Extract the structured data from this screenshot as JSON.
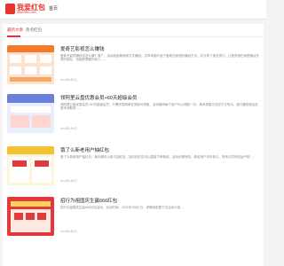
{
  "header": {
    "logo_title": "我爱红包",
    "logo_subtitle": "www.5hb.com",
    "nav_home": "首页"
  },
  "tabs": [
    {
      "label": "最新文章"
    },
    {
      "label": "热点红包"
    }
  ],
  "articles": [
    {
      "title": "爱奇艺影视怎么赚钱",
      "desc": "爱奇艺影视赚钱该怎么赚？推广、活动奖励等各种方式赚钱。文章详细介绍了爱奇艺影视的赚钱方法，并分享了相关技巧，让更多想在家里赚点外快的朋友，也能获得额外收入……",
      "meta": "2024年1月5日"
    },
    {
      "title": "领阿里云盘优惠会员+60天超级会员",
      "desc": "领阿里云盘优惠会员+60天超级会员，只需完成简单任务即可领取，活动期间每个用户可以领取一次，具体领取方法如下文所示，感兴趣的朋友赶紧来领取吧……",
      "meta": "2024年1月5日"
    },
    {
      "title": "饿了么新老用户抽红包",
      "desc": "饿了么新老用户抽红包，每天都可以参与抽红包，抽中的红包可以直接下单使用，活动长期有效，新老用户均可参与，快来试试你的运气吧……",
      "meta": "2024年1月5日"
    },
    {
      "title": "招行为祖国庆生赢666红包",
      "desc": "招行为祖国庆生赢666红包活动，活动时间：2021年10月1日，详情请查看下文活动介绍……",
      "meta": "2024年1月5日"
    }
  ],
  "colors": {
    "brand": "#e8322e",
    "thumb_1": "#f47a2a",
    "thumb_2": "#6a7fd9",
    "thumb_3": "#f2c230",
    "thumb_4": "#e23a3a"
  }
}
